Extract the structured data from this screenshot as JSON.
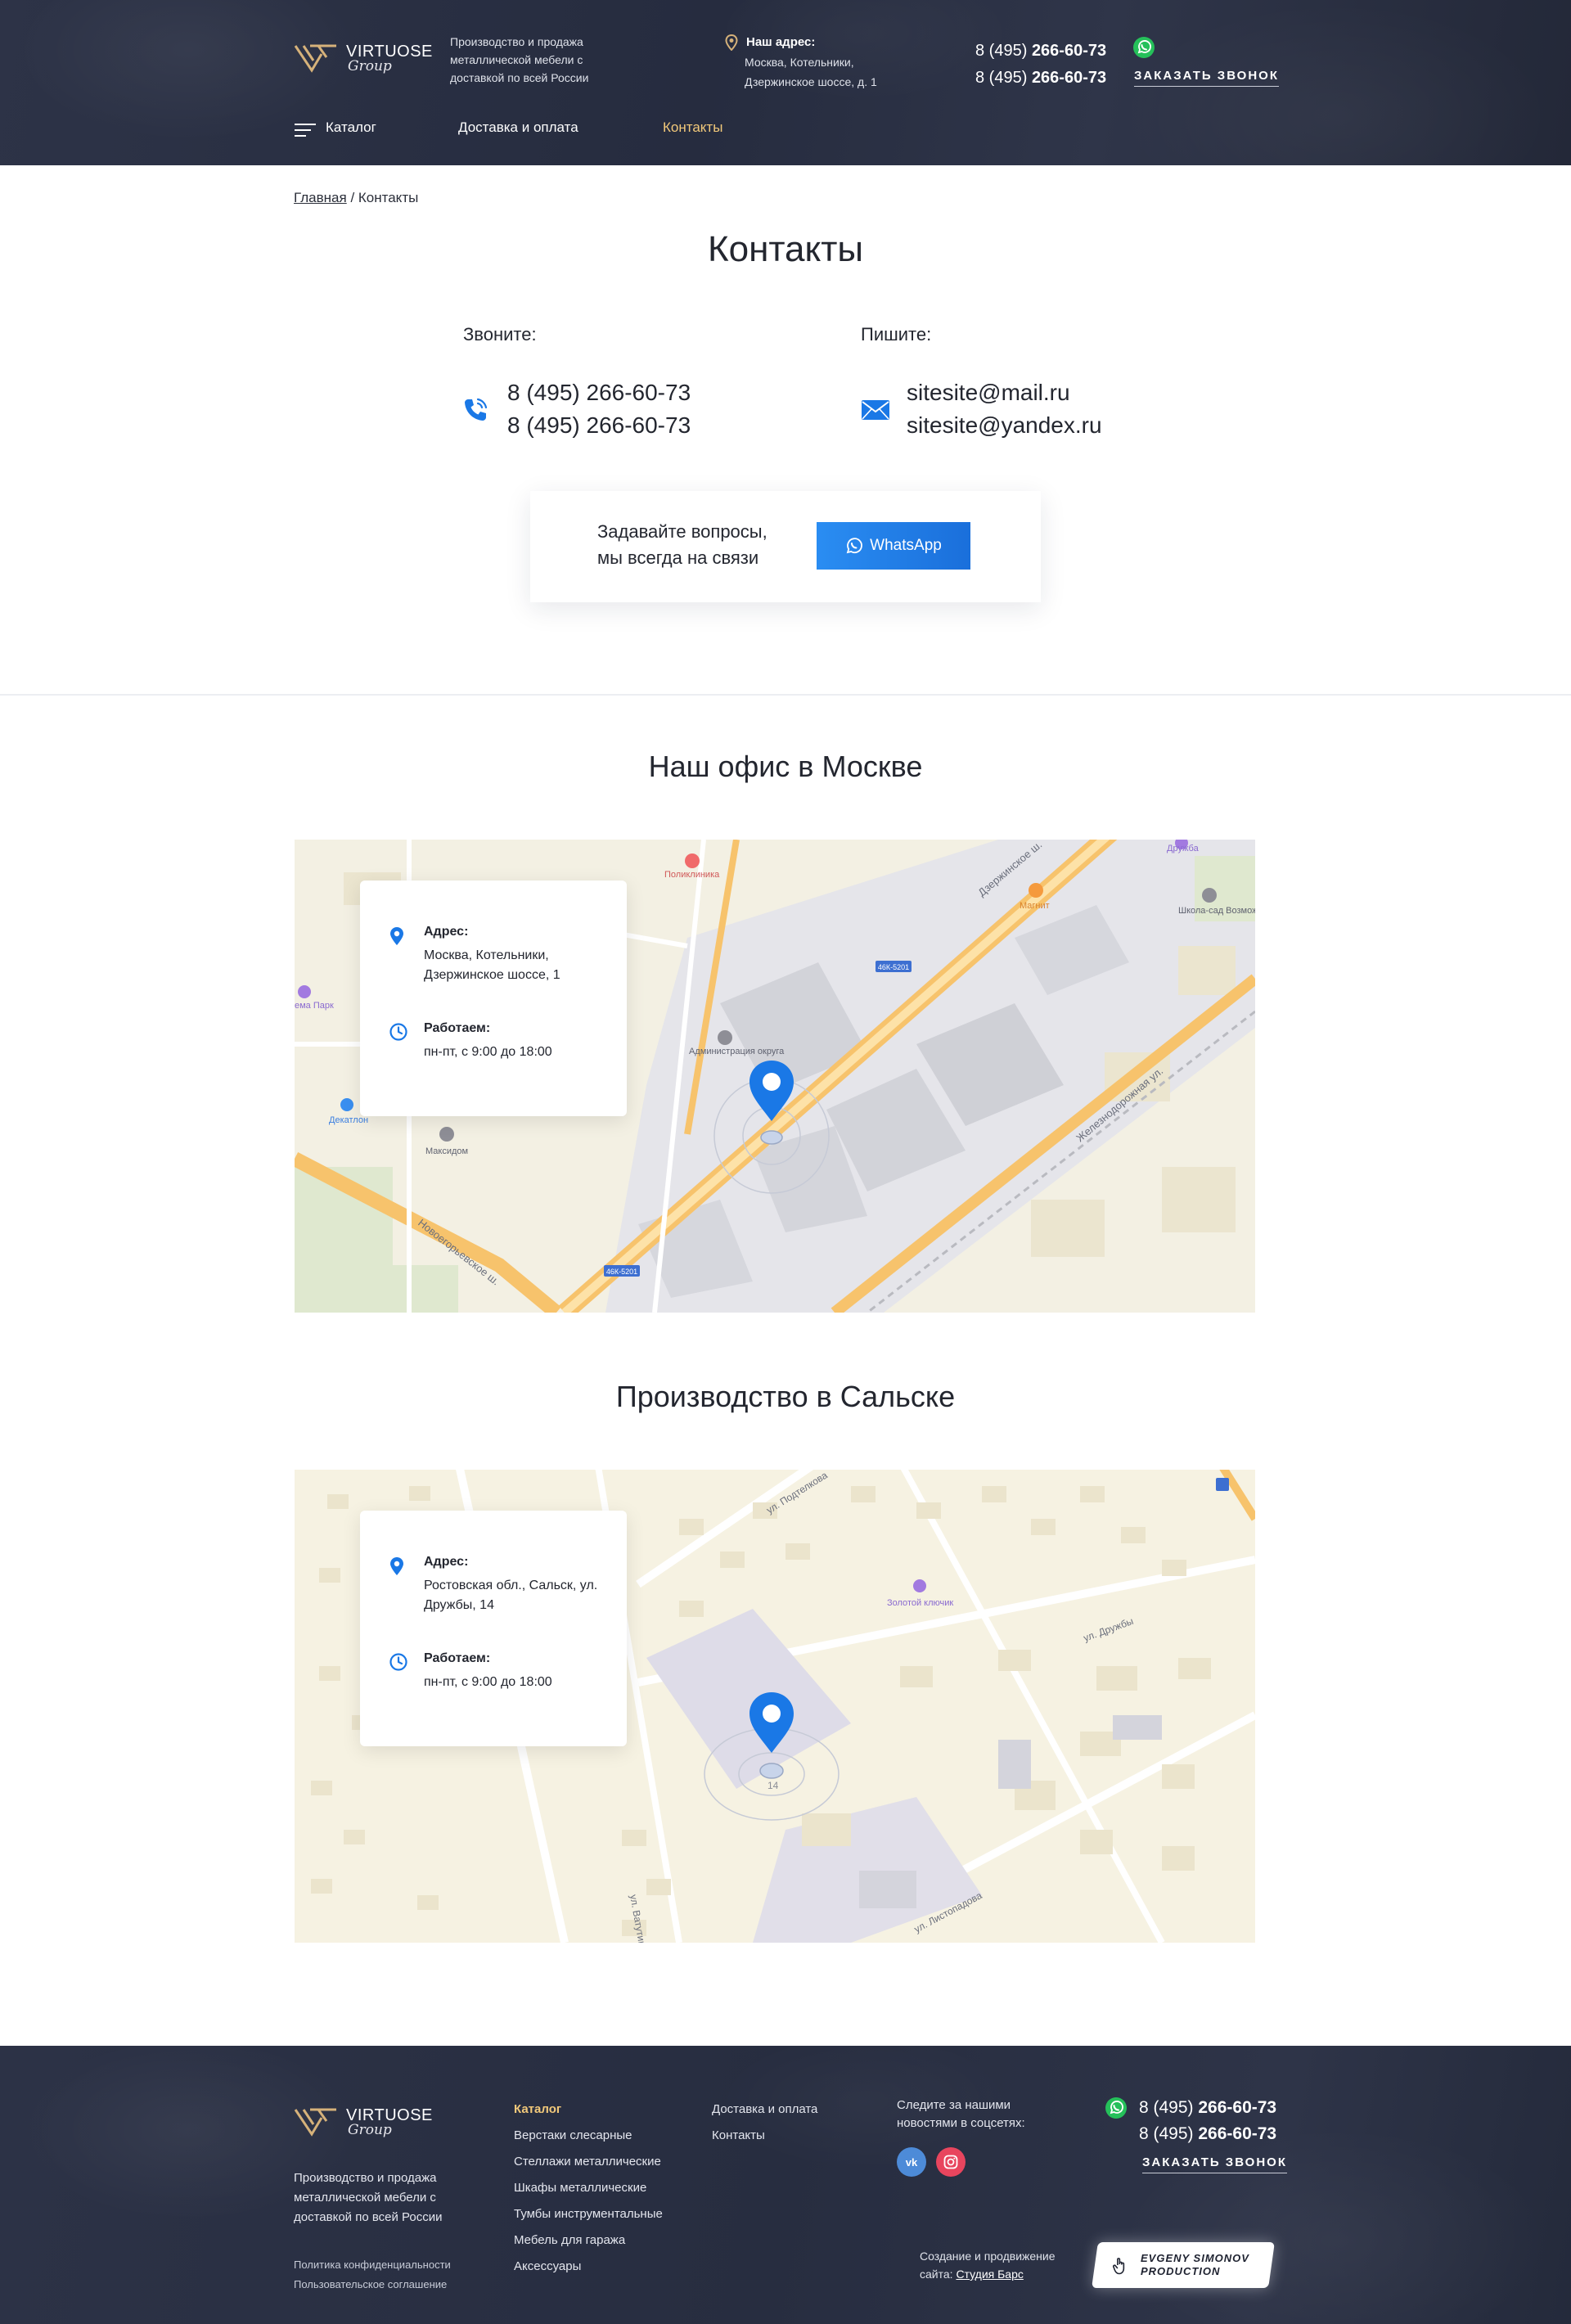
{
  "brand": {
    "name": "VIRTUOSE",
    "sub": "Group",
    "tagline": "Производство и продажа металлической мебели с доставкой по всей России",
    "colors": {
      "accent": "#1a78e6",
      "gold": "#f2c97a",
      "dark": "#272d40"
    }
  },
  "header": {
    "address_title": "Наш адрес:",
    "address": "Москва, Котельники, Дзержинское шоссе, д. 1",
    "phones": [
      {
        "prefix": "8 (495) ",
        "number": "266-60-73"
      },
      {
        "prefix": "8 (495) ",
        "number": "266-60-73"
      }
    ],
    "callback": "ЗАКАЗАТЬ ЗВОНОК",
    "whatsapp_icon": "whatsapp-icon"
  },
  "nav": {
    "catalog": "Каталог",
    "delivery": "Доставка и оплата",
    "contacts": "Контакты"
  },
  "breadcrumb": {
    "home": "Главная",
    "separator": " / ",
    "current": "Контакты"
  },
  "page": {
    "title": "Контакты",
    "call_title": "Звоните:",
    "phones": [
      "8 (495) 266-60-73",
      "8 (495) 266-60-73"
    ],
    "write_title": "Пишите:",
    "emails": [
      "sitesite@mail.ru",
      "sitesite@yandex.ru"
    ],
    "wa_card_text": "Задавайте вопросы, мы всегда на связи",
    "wa_button": "WhatsApp"
  },
  "offices": [
    {
      "title": "Наш офис в Москве",
      "address_label": "Адрес:",
      "address": "Москва, Котельники, Дзержинское шоссе, 1",
      "hours_label": "Работаем:",
      "hours": "пн-пт, с 9:00 до 18:00",
      "map_labels": {
        "clinic": "Поликлиника",
        "magnit": "Магнит",
        "druzhba": "Дружба",
        "school": "Школа-сад Возможность",
        "admin": "Администрация округа",
        "maxidom": "Максидом",
        "decathlon": "Декатлон",
        "park": "ема Парк",
        "road1": "Дзержинское ш.",
        "road2": "Новоегорьевское ш.",
        "road3": "Железнодорожная ул.",
        "badge1": "46К-5201",
        "badge2": "46К-5201"
      }
    },
    {
      "title": "Производство в Сальске",
      "address_label": "Адрес:",
      "address": "Ростовская обл., Сальск, ул. Дружбы, 14",
      "hours_label": "Работаем:",
      "hours": "пн-пт, с 9:00 до 18:00",
      "map_labels": {
        "key": "Золотой ключик",
        "street1": "ул. Подтелкова",
        "street2": "ул. Дружбы",
        "street3": "ул. Листопадова",
        "street4": "ул. Ватутина",
        "house14": "14"
      }
    }
  ],
  "footer": {
    "catalog_head": "Каталог",
    "catalog_items": [
      "Верстаки слесарные",
      "Стеллажи металлические",
      "Шкафы металлические",
      "Тумбы инструментальные",
      "Мебель для гаража",
      "Аксессуары"
    ],
    "info_items": [
      "Доставка и оплата",
      "Контакты"
    ],
    "social_text": "Следите за нашими новостями в соцсетях:",
    "privacy": "Политика конфиденциальности",
    "agreement": "Пользовательское соглашение",
    "phones": [
      {
        "prefix": "8 (495) ",
        "number": "266-60-73"
      },
      {
        "prefix": "8 (495) ",
        "number": "266-60-73"
      }
    ],
    "callback": "ЗАКАЗАТЬ ЗВОНОК",
    "credit": "Создание и продвижение сайта:",
    "studio": "Студия Барс",
    "developer": "EVGENY SIMONOV PRODUCTION"
  }
}
